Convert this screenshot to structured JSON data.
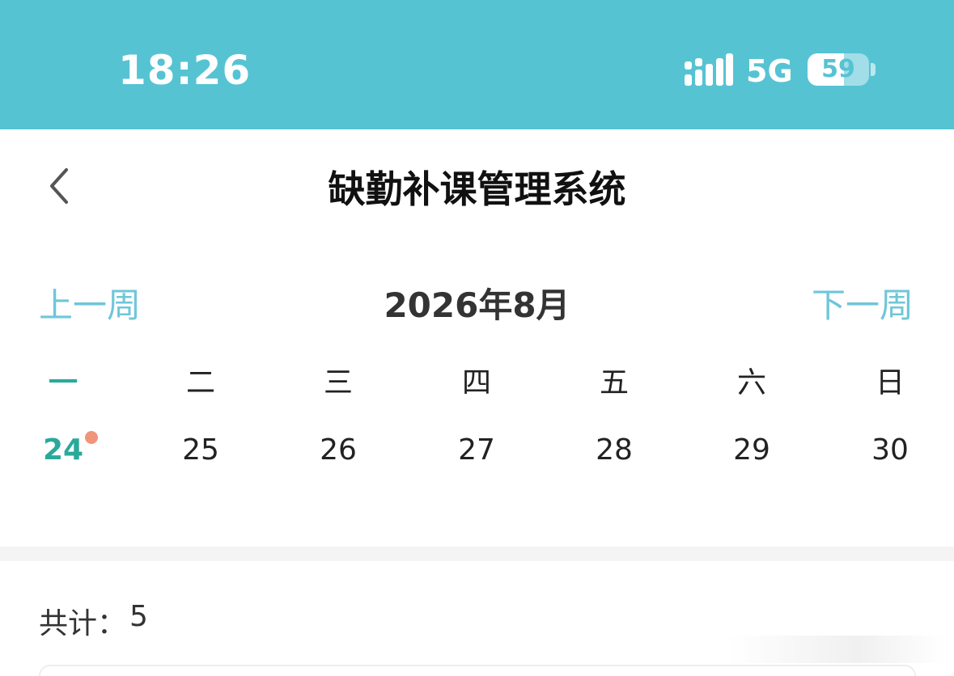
{
  "status_bar": {
    "time": "18:26",
    "network": "5G",
    "battery_percent": 59,
    "battery_label": "59",
    "bg_color": "#56c3d3"
  },
  "nav": {
    "back_icon": "chevron-left-icon",
    "title": "缺勤补课管理系统"
  },
  "calendar": {
    "prev_week_label": "上一周",
    "month_label": "2026年8月",
    "next_week_label": "下一周",
    "accent_color": "#2aa99b",
    "link_color": "#6fc6da",
    "weekdays": [
      "一",
      "二",
      "三",
      "四",
      "五",
      "六",
      "日"
    ],
    "days": [
      "24",
      "25",
      "26",
      "27",
      "28",
      "29",
      "30"
    ],
    "selected_index": 0,
    "marker_color": "#f0957a"
  },
  "summary": {
    "total_label": "共计：",
    "total_value": "5"
  }
}
